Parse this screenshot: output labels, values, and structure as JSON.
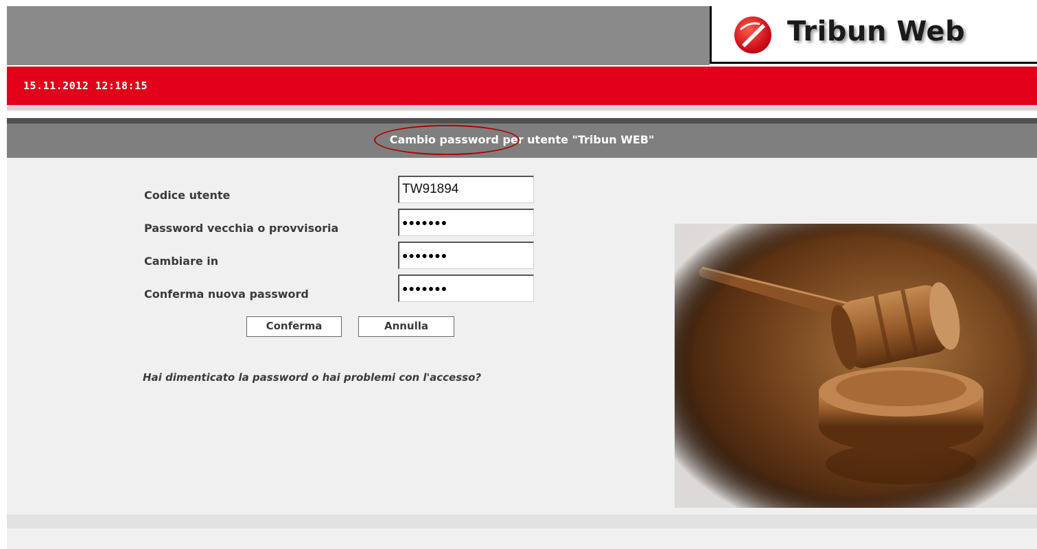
{
  "header": {
    "brand": "Tribun Web",
    "brand_color": "#e2001a",
    "datetime": "15.11.2012 12:18:15"
  },
  "form": {
    "title": "Cambio password per utente \"Tribun WEB\"",
    "fields": [
      {
        "label": "Codice utente",
        "value": "TW91894"
      },
      {
        "label": "Password vecchia o provvisoria",
        "value": "●●●●●●●"
      },
      {
        "label": "Cambiare in",
        "value": "●●●●●●●"
      },
      {
        "label": "Conferma nuova password",
        "value": "●●●●●●●"
      }
    ],
    "confirm_label": "Conferma",
    "cancel_label": "Annulla",
    "help_text": "Hai dimenticato la password o hai problemi con l'accesso?"
  },
  "decorative": {
    "image": "gavel-image",
    "logo_icon": "unicredit-logo-icon"
  }
}
